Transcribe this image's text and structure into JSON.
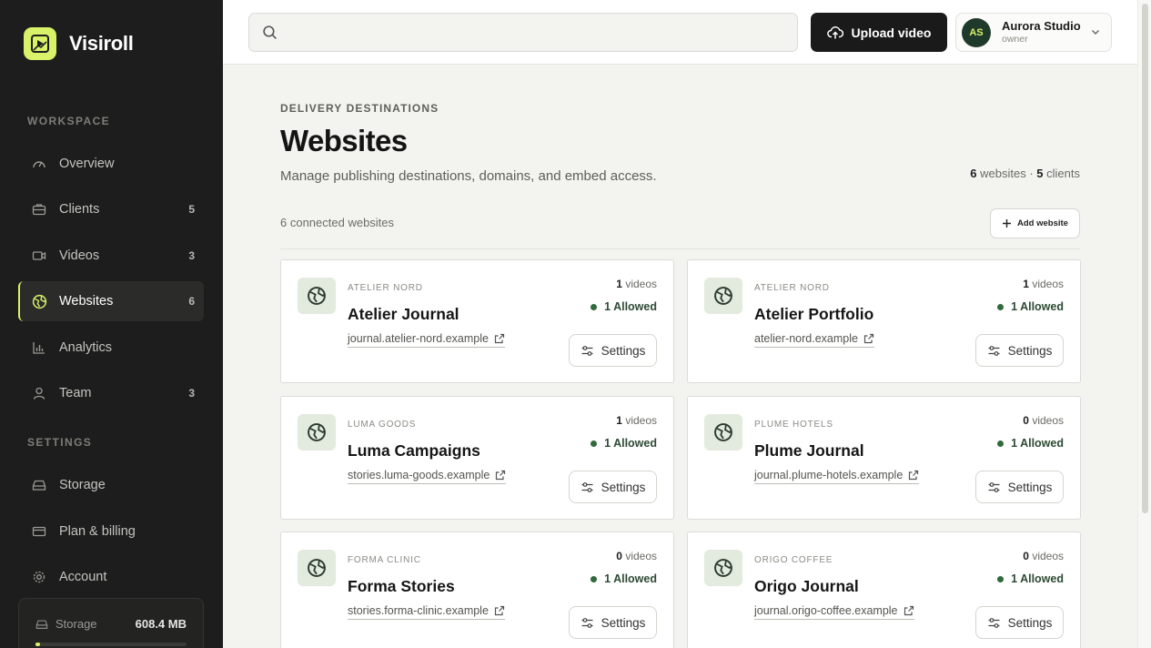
{
  "app": {
    "name": "Visiroll",
    "accent": "#d8f26a"
  },
  "sidebar": {
    "workspace_label": "WORKSPACE",
    "settings_label": "SETTINGS",
    "workspace_items": [
      {
        "label": "Overview",
        "icon": "gauge-icon",
        "count": ""
      },
      {
        "label": "Clients",
        "icon": "briefcase-icon",
        "count": "5"
      },
      {
        "label": "Videos",
        "icon": "video-camera-icon",
        "count": "3"
      },
      {
        "label": "Websites",
        "icon": "globe-icon",
        "count": "6",
        "active": true
      },
      {
        "label": "Analytics",
        "icon": "bar-chart-icon",
        "count": ""
      },
      {
        "label": "Team",
        "icon": "user-icon",
        "count": "3"
      }
    ],
    "settings_items": [
      {
        "label": "Storage",
        "icon": "drive-icon"
      },
      {
        "label": "Plan & billing",
        "icon": "credit-card-icon"
      },
      {
        "label": "Account",
        "icon": "gear-icon"
      }
    ],
    "storage": {
      "label": "Storage",
      "value": "608.4 MB",
      "fraction": 0.03
    }
  },
  "topbar": {
    "search_placeholder": "",
    "upload_label": "Upload video",
    "account": {
      "initials": "AS",
      "name": "Aurora Studio",
      "role": "owner"
    }
  },
  "main": {
    "eyebrow": "DELIVERY DESTINATIONS",
    "title": "Websites",
    "subtitle": "Manage publishing destinations, domains, and embed access.",
    "summary": {
      "websites_count": "6",
      "websites_label": "websites",
      "sep": "·",
      "clients_count": "5",
      "clients_label": "clients"
    },
    "connected_text": "6 connected websites",
    "add_label": "Add website",
    "settings_label": "Settings",
    "videos_word": "videos",
    "cards": [
      {
        "client": "ATELIER NORD",
        "title": "Atelier Journal",
        "domain": "journal.atelier-nord.example",
        "videos": "1",
        "allowed": "1 Allowed"
      },
      {
        "client": "ATELIER NORD",
        "title": "Atelier Portfolio",
        "domain": "atelier-nord.example",
        "videos": "1",
        "allowed": "1 Allowed"
      },
      {
        "client": "LUMA GOODS",
        "title": "Luma Campaigns",
        "domain": "stories.luma-goods.example",
        "videos": "1",
        "allowed": "1 Allowed"
      },
      {
        "client": "PLUME HOTELS",
        "title": "Plume Journal",
        "domain": "journal.plume-hotels.example",
        "videos": "0",
        "allowed": "1 Allowed"
      },
      {
        "client": "FORMA CLINIC",
        "title": "Forma Stories",
        "domain": "stories.forma-clinic.example",
        "videos": "0",
        "allowed": "1 Allowed"
      },
      {
        "client": "ORIGO COFFEE",
        "title": "Origo Journal",
        "domain": "journal.origo-coffee.example",
        "videos": "0",
        "allowed": "1 Allowed"
      }
    ]
  }
}
